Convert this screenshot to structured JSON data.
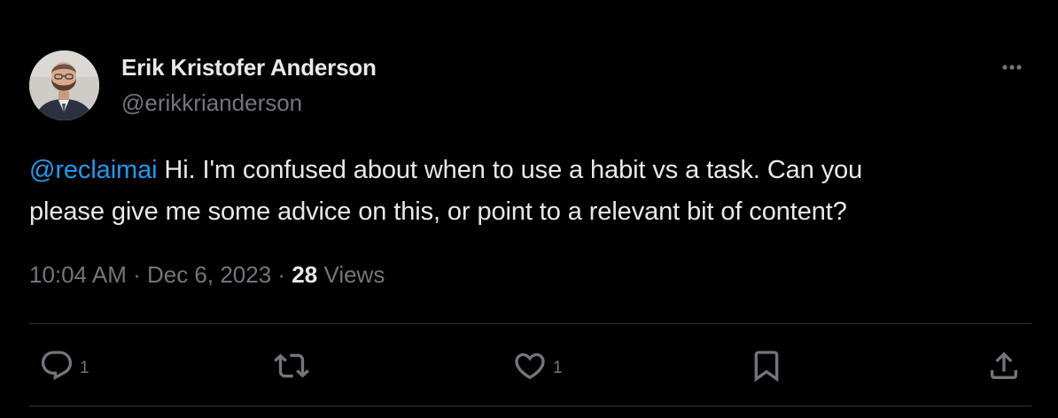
{
  "author": {
    "name": "Erik Kristofer Anderson",
    "handle": "@erikkrianderson"
  },
  "tweet": {
    "mention": "@reclaimai",
    "line1_text": " Hi. I'm confused about when to use a habit vs a task. Can you",
    "line2_text": "please give me some advice on this, or point to a relevant bit of content?"
  },
  "meta": {
    "time": "10:04 AM",
    "sep1": " · ",
    "date": "Dec 6, 2023",
    "sep2": " · ",
    "views_count": "28",
    "views_label": " Views"
  },
  "actions": {
    "reply_count": "1",
    "like_count": "1"
  },
  "colors": {
    "background": "#000000",
    "text": "#e7e9ea",
    "secondary": "#71767b",
    "link": "#1d9bf0",
    "divider": "#2f3336"
  },
  "icons": [
    "more-icon",
    "reply-icon",
    "retweet-icon",
    "like-icon",
    "bookmark-icon",
    "share-icon"
  ]
}
